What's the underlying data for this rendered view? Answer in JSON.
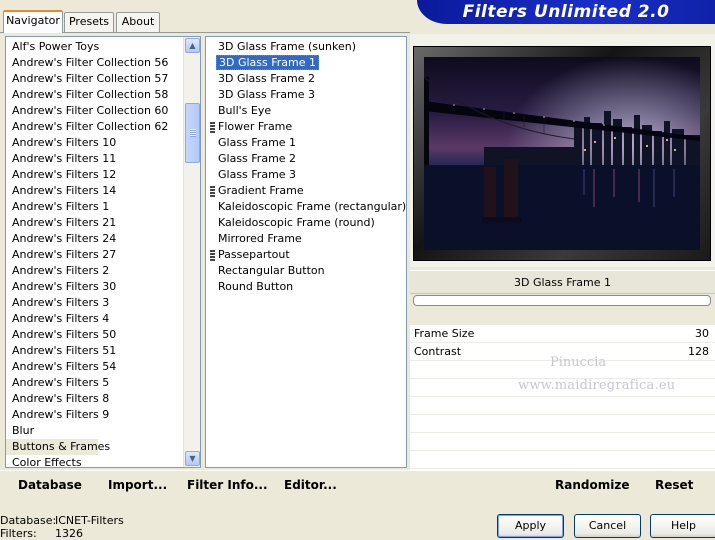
{
  "tabs": [
    "Navigator",
    "Presets",
    "About"
  ],
  "app_title": "Filters Unlimited 2.0",
  "categories": [
    "Alf's Power Toys",
    "Andrew's Filter Collection 56",
    "Andrew's Filter Collection 57",
    "Andrew's Filter Collection 58",
    "Andrew's Filter Collection 60",
    "Andrew's Filter Collection 62",
    "Andrew's Filters 10",
    "Andrew's Filters 11",
    "Andrew's Filters 12",
    "Andrew's Filters 14",
    "Andrew's Filters 1",
    "Andrew's Filters 21",
    "Andrew's Filters 24",
    "Andrew's Filters 27",
    "Andrew's Filters 2",
    "Andrew's Filters 30",
    "Andrew's Filters 3",
    "Andrew's Filters 4",
    "Andrew's Filters 50",
    "Andrew's Filters 51",
    "Andrew's Filters 54",
    "Andrew's Filters 5",
    "Andrew's Filters 8",
    "Andrew's Filters 9",
    "Blur",
    "Buttons & Frames",
    "Color Effects"
  ],
  "selected_category": "Buttons & Frames",
  "filters": [
    {
      "label": "3D Glass Frame (sunken)",
      "grip": false
    },
    {
      "label": "3D Glass Frame 1",
      "grip": false
    },
    {
      "label": "3D Glass Frame 2",
      "grip": false
    },
    {
      "label": "3D Glass Frame 3",
      "grip": false
    },
    {
      "label": "Bull's Eye",
      "grip": false
    },
    {
      "label": "Flower Frame",
      "grip": true
    },
    {
      "label": "Glass Frame 1",
      "grip": false
    },
    {
      "label": "Glass Frame 2",
      "grip": false
    },
    {
      "label": "Glass Frame 3",
      "grip": false
    },
    {
      "label": "Gradient Frame",
      "grip": true
    },
    {
      "label": "Kaleidoscopic Frame (rectangular)",
      "grip": false
    },
    {
      "label": "Kaleidoscopic Frame (round)",
      "grip": false
    },
    {
      "label": "Mirrored Frame",
      "grip": false
    },
    {
      "label": "Passepartout",
      "grip": true
    },
    {
      "label": "Rectangular Button",
      "grip": false
    },
    {
      "label": "Round Button",
      "grip": false
    }
  ],
  "selected_filter": "3D Glass Frame 1",
  "filter_name": "3D Glass Frame 1",
  "params": [
    {
      "name": "Frame Size",
      "value": "30"
    },
    {
      "name": "Contrast",
      "value": "128"
    }
  ],
  "watermark": {
    "line1": "Pinuccia",
    "line2": "www.maidiregrafica.eu"
  },
  "link_buttons": {
    "database": "Database",
    "import": "Import...",
    "filter_info": "Filter Info...",
    "editor": "Editor...",
    "randomize": "Randomize",
    "reset": "Reset"
  },
  "status": {
    "database_label": "Database:",
    "database_value": "ICNET-Filters",
    "filters_label": "Filters:",
    "filters_value": "1326"
  },
  "buttons": {
    "apply": "Apply",
    "cancel": "Cancel",
    "help": "Help"
  },
  "colors": {
    "banner": "#1a2ec8",
    "selection": "#316ac5",
    "tab_accent": "#e68b2c"
  },
  "icons": {
    "scroll_up": "triangle-up",
    "scroll_down": "triangle-down"
  }
}
